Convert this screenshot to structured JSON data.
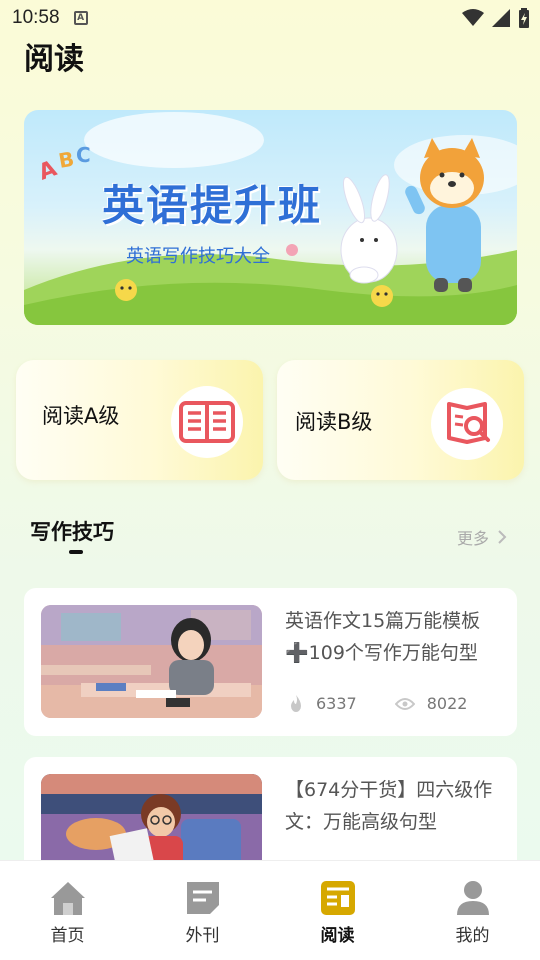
{
  "status_bar": {
    "time": "10:58",
    "indicator": "A"
  },
  "page": {
    "title": "阅读"
  },
  "banner": {
    "badge": "ABC",
    "title": "英语提升班",
    "subtitle": "英语写作技巧大全"
  },
  "levels": [
    {
      "label": "阅读A级",
      "icon": "book-open-icon",
      "icon_color": "#e9575e"
    },
    {
      "label": "阅读B级",
      "icon": "book-search-icon",
      "icon_color": "#e9575e"
    }
  ],
  "section": {
    "title": "写作技巧",
    "more": "更多"
  },
  "articles": [
    {
      "title": "英语作文15篇万能模板➕109个写作万能句型",
      "likes": "6337",
      "views": "8022"
    },
    {
      "title": "【674分干货】四六级作文：万能高级句型"
    }
  ],
  "tabbar": {
    "items": [
      {
        "label": "首页",
        "icon": "home-icon"
      },
      {
        "label": "外刊",
        "icon": "magazine-icon"
      },
      {
        "label": "阅读",
        "icon": "reading-icon"
      },
      {
        "label": "我的",
        "icon": "user-icon"
      }
    ],
    "active": "阅读",
    "accent": "#d6a800"
  }
}
